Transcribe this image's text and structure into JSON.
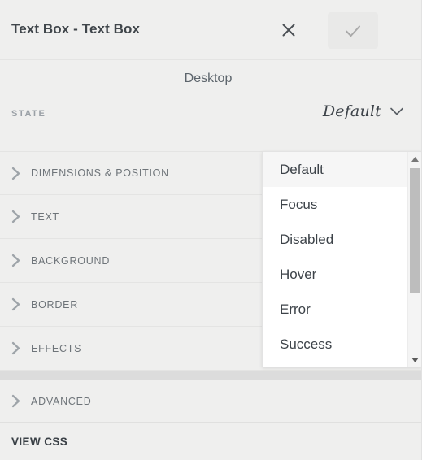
{
  "header": {
    "title": "Text Box - Text Box",
    "close_icon": "close-icon",
    "confirm_icon": "check-icon"
  },
  "device": {
    "label": "Desktop"
  },
  "state": {
    "label": "STATE",
    "selected_value": "Default",
    "chevron_icon": "chevron-down-icon"
  },
  "sections": [
    {
      "label": "DIMENSIONS & POSITION",
      "icon": "chevron-right-icon"
    },
    {
      "label": "TEXT",
      "icon": "chevron-right-icon"
    },
    {
      "label": "BACKGROUND",
      "icon": "chevron-right-icon"
    },
    {
      "label": "BORDER",
      "icon": "chevron-right-icon"
    },
    {
      "label": "EFFECTS",
      "icon": "chevron-right-icon"
    }
  ],
  "advanced": {
    "label": "ADVANCED",
    "icon": "chevron-right-icon"
  },
  "view_css": {
    "label": "VIEW CSS"
  },
  "dropdown": {
    "options": [
      {
        "label": "Default",
        "selected": true
      },
      {
        "label": "Focus",
        "selected": false
      },
      {
        "label": "Disabled",
        "selected": false
      },
      {
        "label": "Hover",
        "selected": false
      },
      {
        "label": "Error",
        "selected": false
      },
      {
        "label": "Success",
        "selected": false
      }
    ],
    "scroll_up_icon": "triangle-up-icon",
    "scroll_down_icon": "triangle-down-icon"
  },
  "colors": {
    "panel_bg": "#efefee",
    "band": "#dcdcdc",
    "text_primary": "#3d4349",
    "text_muted": "#6e7479",
    "dropdown_bg": "#ffffff",
    "dropdown_selected": "#f6f6f6",
    "scrollbar_thumb": "#bdbdbd"
  }
}
